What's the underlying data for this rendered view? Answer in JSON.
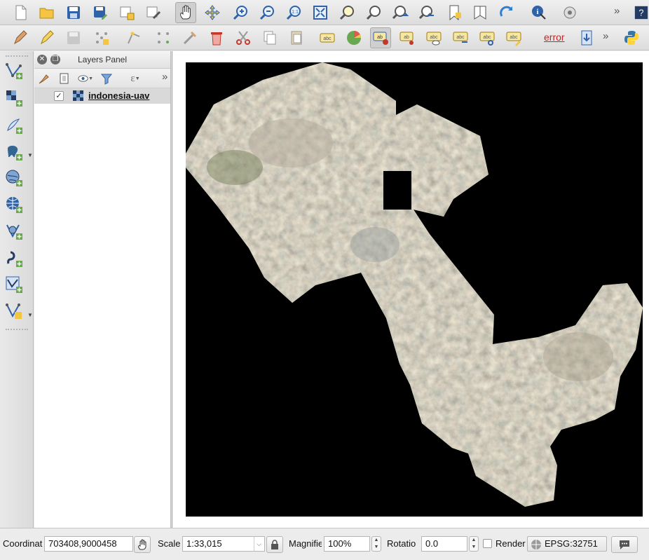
{
  "toolbar2": {
    "error_label": "error"
  },
  "layers_panel": {
    "title": "Layers Panel",
    "layers": [
      {
        "name": "indonesia-uav",
        "checked": "✓"
      }
    ]
  },
  "statusbar": {
    "coordinate_label": "Coordinate",
    "coordinate_value": "703408,9000458",
    "scale_label": "Scale",
    "scale_value": "1:33,015",
    "magnifier_label": "Magnifier",
    "magnifier_value": "100%",
    "rotation_label": "Rotation",
    "rotation_value": "0.0",
    "render_label": "Render",
    "crs_label": "EPSG:32751"
  },
  "colors": {
    "accent": "#2f7fd0",
    "map_background": "#000000",
    "selected_row": "#d9d9d9",
    "error": "#d21f1f"
  },
  "icons": {
    "toolbar1": [
      "new-project-icon",
      "open-project-icon",
      "save-project-icon",
      "save-as-icon",
      "new-print-layout-icon",
      "layout-manager-icon",
      "pan-icon",
      "pan-to-selection-icon",
      "zoom-in-icon",
      "zoom-out-icon",
      "zoom-native-icon",
      "zoom-full-icon",
      "zoom-to-selection-icon",
      "zoom-to-layer-icon",
      "zoom-last-icon",
      "zoom-next-icon",
      "new-bookmark-icon",
      "show-bookmarks-icon",
      "refresh-icon",
      "identify-icon",
      "select-features-icon",
      "help-icon"
    ],
    "left": [
      "add-vector-layer-icon",
      "add-raster-layer-icon",
      "add-delimited-text-icon",
      "add-postgis-layer-icon",
      "add-spatialite-layer-icon",
      "add-wms-layer-icon",
      "add-wfs-layer-icon",
      "add-wcs-layer-icon",
      "new-shapefile-icon",
      "new-temp-layer-icon"
    ]
  }
}
